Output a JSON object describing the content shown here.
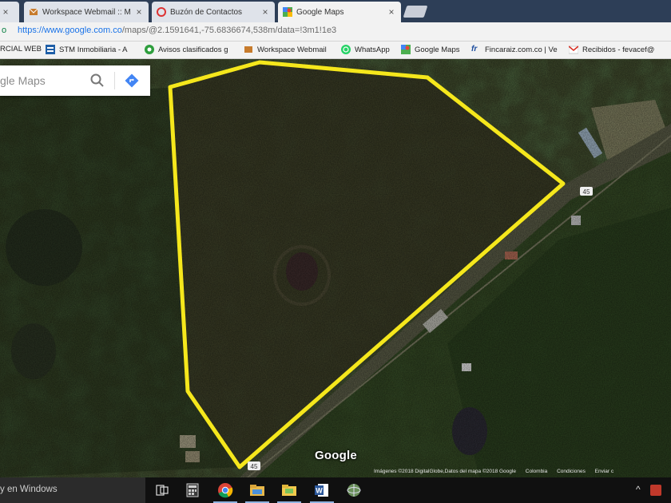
{
  "tabs": [
    {
      "label": "Workspace Webmail :: M",
      "favicon": "webmail-icon",
      "close": "×"
    },
    {
      "label": "Buzón de Contactos",
      "favicon": "contacts-icon",
      "close": "×"
    },
    {
      "label": "Google Maps",
      "favicon": "google-maps-icon",
      "close": "×",
      "active": true
    }
  ],
  "address_bar": {
    "url_host": "https://www.google.com.co",
    "url_path": "/maps/@2.1591641,-75.6836674,538m/data=!3m1!1e3"
  },
  "bookmarks": [
    {
      "label": "RCIAL WEB",
      "icon": "page-icon"
    },
    {
      "label": "STM Inmobiliaria - A",
      "icon": "stm-icon"
    },
    {
      "label": "Avisos clasificados g",
      "icon": "classifieds-icon"
    },
    {
      "label": "Workspace Webmail",
      "icon": "webmail-icon"
    },
    {
      "label": "WhatsApp",
      "icon": "whatsapp-icon"
    },
    {
      "label": "Google Maps",
      "icon": "google-maps-icon"
    },
    {
      "label": "Fincaraiz.com.co | Ve",
      "icon": "fincaraiz-icon"
    },
    {
      "label": "Recibidos - fevacef@",
      "icon": "gmail-icon"
    }
  ],
  "map": {
    "search_placeholder": "gle Maps",
    "google_logo": "Google",
    "road_shield": "45",
    "attribution": [
      "Imágenes ©2018 DigitalGlobe,Datos del mapa ©2018 Google",
      "Colombia",
      "Condiciones",
      "Enviar c"
    ],
    "boundary_color": "#f5e71c"
  },
  "taskbar": {
    "search_text": "y en Windows",
    "apps": [
      "task-view-icon",
      "calculator-icon",
      "chrome-icon",
      "file-explorer-icon",
      "folder-icon",
      "word-icon",
      "network-icon"
    ],
    "tray": "^"
  }
}
